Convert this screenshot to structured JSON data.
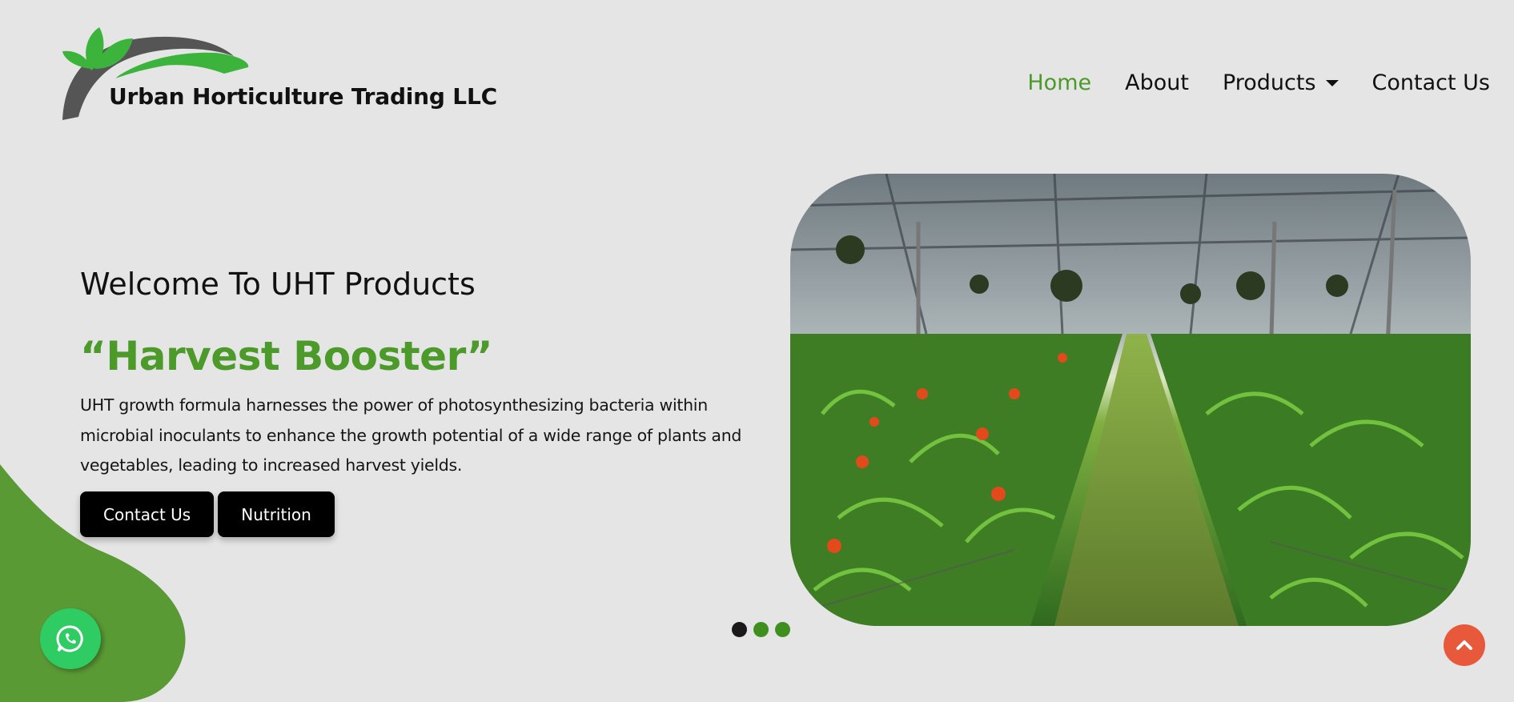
{
  "brand": {
    "name": "Urban Horticulture Trading LLC",
    "colors": {
      "green": "#4b9a2a",
      "leaf": "#3cb43c",
      "swoosh": "#555555"
    }
  },
  "nav": {
    "items": [
      {
        "label": "Home",
        "active": true
      },
      {
        "label": "About",
        "active": false
      },
      {
        "label": "Products",
        "active": false,
        "dropdown": true
      },
      {
        "label": "Contact Us",
        "active": false
      }
    ]
  },
  "hero": {
    "welcome": "Welcome To UHT Products",
    "headline": "“Harvest Booster”",
    "description": "UHT growth formula harnesses the power of photosynthesizing bacteria within microbial inoculants to enhance the growth potential of a wide range of plants and vegetables, leading to increased harvest yields.",
    "buttons": {
      "contact": "Contact Us",
      "nutrition": "Nutrition"
    },
    "image": "greenhouse-photo"
  },
  "carousel": {
    "dots": [
      {
        "color": "#1a1a1a",
        "active": true
      },
      {
        "color": "#3f8f1f",
        "active": false
      },
      {
        "color": "#3f8f1f",
        "active": false
      }
    ]
  },
  "floating": {
    "whatsapp_icon": "whatsapp-icon",
    "whatsapp_color": "#2ecc63",
    "scroll_top_icon": "chevron-up-icon",
    "scroll_top_color": "#e8593c"
  }
}
